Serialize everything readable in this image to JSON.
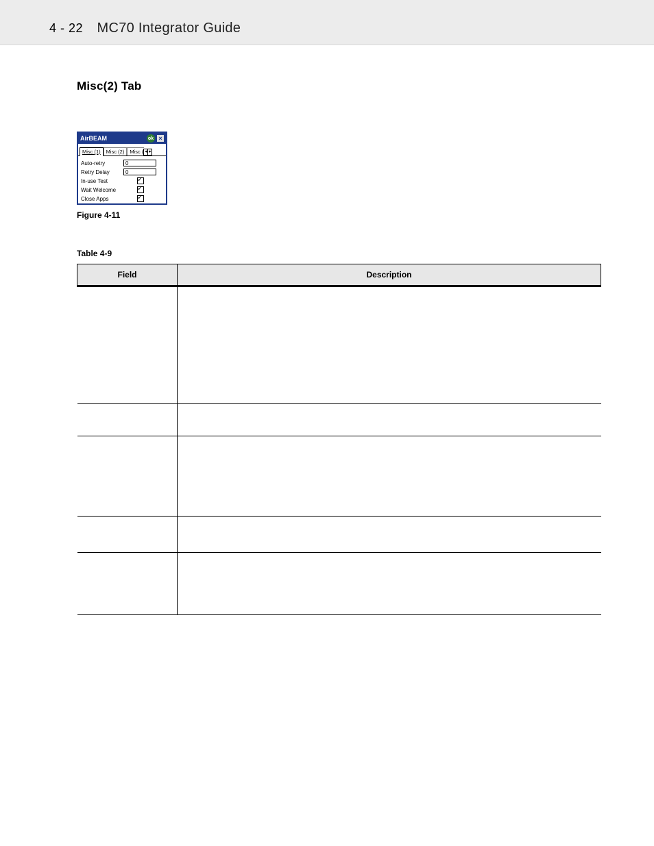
{
  "header": {
    "page_number": "4 - 22",
    "guide_title": "MC70 Integrator Guide"
  },
  "section_heading": "Misc(2) Tab",
  "screenshot": {
    "titlebar": {
      "title": "AirBEAM",
      "ok": "ok",
      "close": "×"
    },
    "tabs": {
      "t1": "Misc (1)",
      "t2": "Misc (2)",
      "t3": "Misc (",
      "arr_left": "◂",
      "arr_right": "▸"
    },
    "rows": {
      "auto_retry": {
        "label": "Auto-retry",
        "value": "0"
      },
      "retry_delay": {
        "label": "Retry Delay",
        "value": "0"
      },
      "inuse_test": {
        "label": "In-use Test"
      },
      "wait_welcome": {
        "label": "Wait Welcome"
      },
      "close_apps": {
        "label": "Close Apps"
      }
    }
  },
  "figure_caption": "Figure 4-11",
  "table_caption": "Table 4-9",
  "table": {
    "headers": {
      "field": "Field",
      "description": "Description"
    },
    "rows": [
      {
        "field": "",
        "description": ""
      },
      {
        "field": "",
        "description": ""
      },
      {
        "field": "",
        "description": ""
      },
      {
        "field": "",
        "description": ""
      },
      {
        "field": "",
        "description": ""
      }
    ]
  }
}
